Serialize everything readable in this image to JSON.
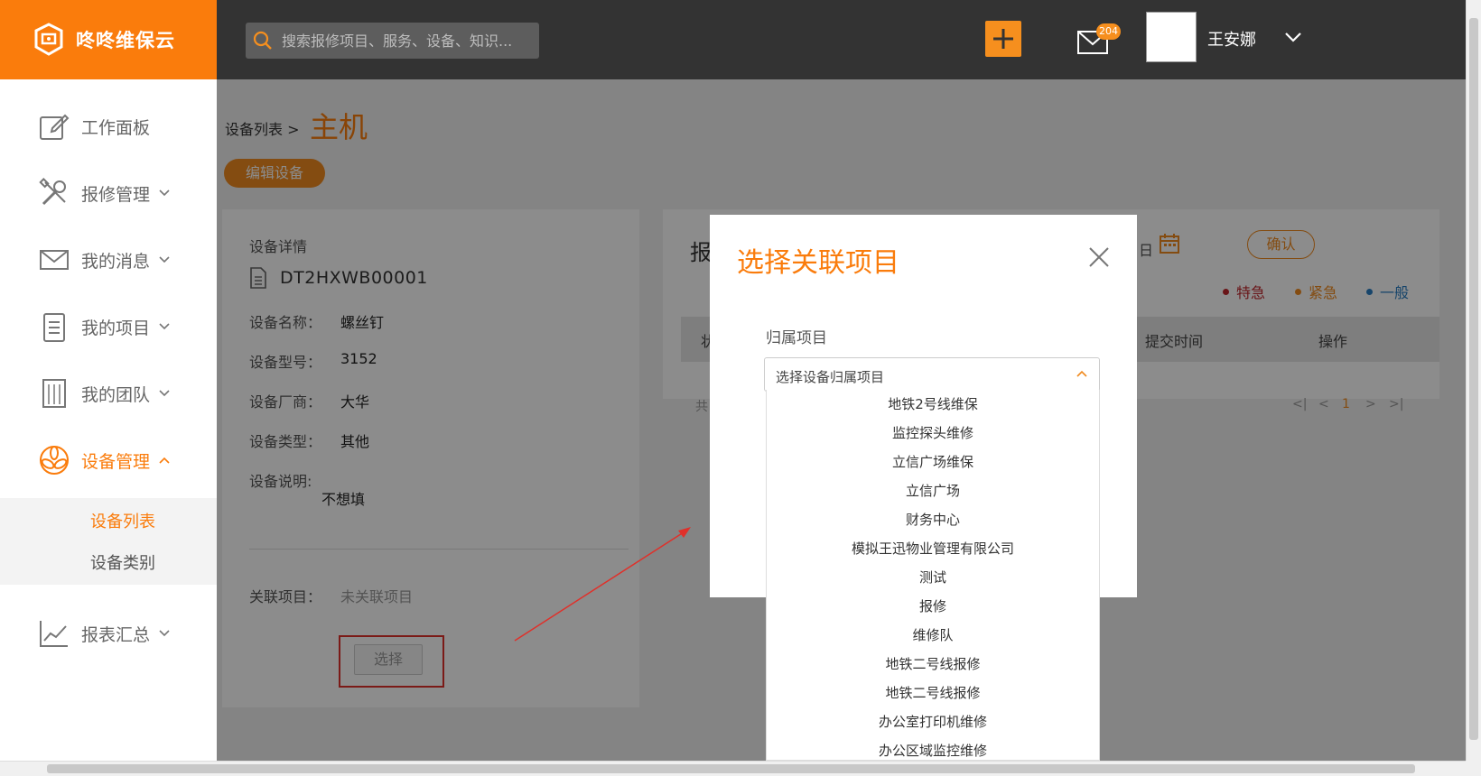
{
  "brand": {
    "name": "咚咚维保云",
    "color": "#fa7c0c"
  },
  "header": {
    "search_placeholder": "搜索报修项目、服务、设备、知识...",
    "mail_badge": "204",
    "user_name": "王安娜"
  },
  "sidebar": {
    "items": [
      {
        "label": "工作面板",
        "icon": "dashboard-edit-icon"
      },
      {
        "label": "报修管理",
        "icon": "tools-icon"
      },
      {
        "label": "我的消息",
        "icon": "envelope-icon"
      },
      {
        "label": "我的项目",
        "icon": "clipboard-icon"
      },
      {
        "label": "我的团队",
        "icon": "building-icon"
      },
      {
        "label": "设备管理",
        "icon": "fan-icon"
      },
      {
        "label": "报表汇总",
        "icon": "chart-line-icon"
      }
    ],
    "sub_items": [
      "设备列表",
      "设备类别"
    ]
  },
  "breadcrumb": {
    "parent": "设备列表 >",
    "current": "主机"
  },
  "edit_button": "编辑设备",
  "device": {
    "section_title": "设备详情",
    "code": "DT2HXWB00001",
    "fields": [
      {
        "label": "设备名称：",
        "value": "螺丝钉"
      },
      {
        "label": "设备型号：",
        "value": "3152"
      },
      {
        "label": "设备厂商：",
        "value": "大华"
      },
      {
        "label": "设备类型：",
        "value": "其他"
      }
    ],
    "description_label": "设备说明:",
    "description_value": "不想填",
    "related_label": "关联项目：",
    "related_value": "未关联项目",
    "select_button": "选择"
  },
  "right_panel": {
    "title_fragment": "报",
    "date_fragment": "日",
    "confirm": "确认",
    "legend": [
      {
        "label": "特急",
        "color": "#c0272d"
      },
      {
        "label": "紧急",
        "color": "#f08a1f"
      },
      {
        "label": "一般",
        "color": "#2b7fc3"
      }
    ],
    "table_headers": {
      "status_fragment": "状",
      "submit_time": "提交时间",
      "action": "操作"
    },
    "total_fragment": "共",
    "pager": {
      "first": "<|",
      "prev": "<",
      "page": "1",
      "next": ">",
      "last": ">|"
    }
  },
  "modal": {
    "title": "选择关联项目",
    "field_label": "归属项目",
    "select_placeholder": "选择设备归属项目",
    "options": [
      "地铁2号线维保",
      "监控探头维修",
      "立信广场维保",
      "立信广场",
      "财务中心",
      "模拟王迅物业管理有限公司",
      "测试",
      "报修",
      "维修队",
      "地铁二号线报修",
      "地铁二号线报修",
      "办公室打印机维修",
      "办公区域监控维修"
    ]
  }
}
